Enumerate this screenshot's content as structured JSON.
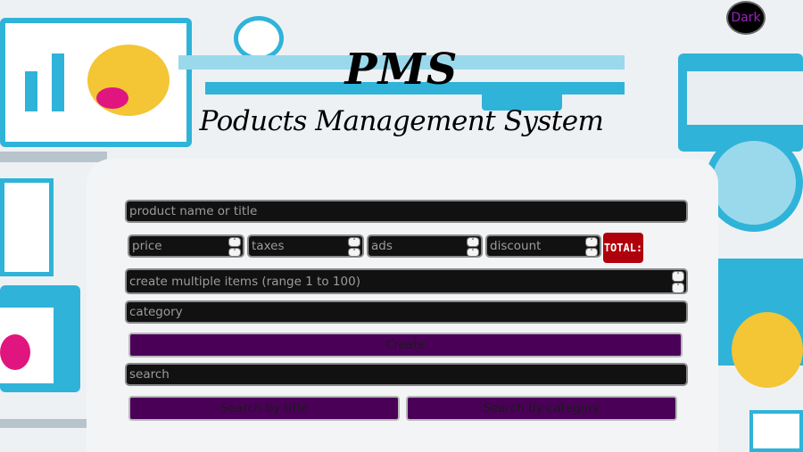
{
  "theme_toggle": {
    "label": "Dark"
  },
  "header": {
    "title": "PMS",
    "subtitle": "Poducts Management System"
  },
  "form": {
    "title_placeholder": "product name or title",
    "price_placeholder": "price",
    "taxes_placeholder": "taxes",
    "ads_placeholder": "ads",
    "discount_placeholder": "discount",
    "total_label": "TOTAL:",
    "count_placeholder": "create multiple items (range 1 to 100)",
    "category_placeholder": "category",
    "create_label": "Create"
  },
  "search": {
    "placeholder": "search",
    "by_title_label": "Search by title",
    "by_category_label": "Search by category"
  },
  "colors": {
    "field_bg": "#111111",
    "button_bg": "#4b0058",
    "total_bg": "#b0000c",
    "card_bg": "#f3f4f6",
    "toggle_text": "#a020c8",
    "accent_blue": "#2fb3d9"
  }
}
